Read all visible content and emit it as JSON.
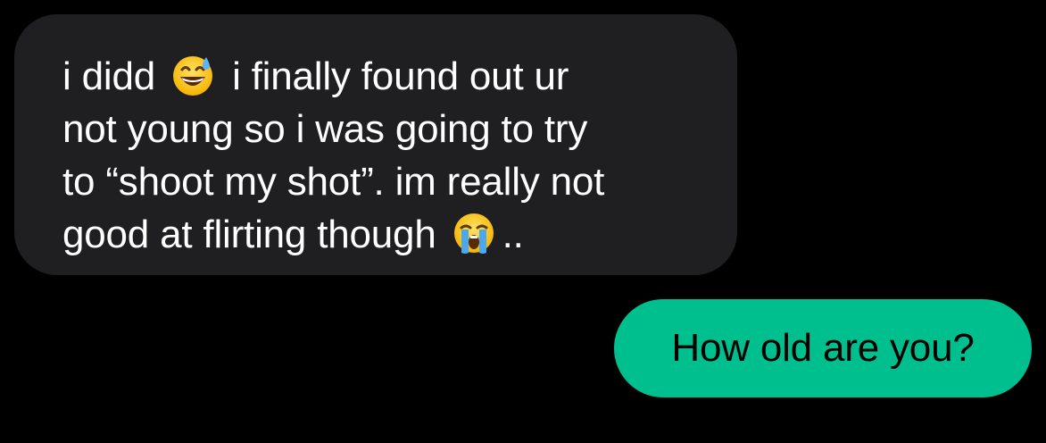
{
  "conversation": {
    "received_message": {
      "line1_before_emoji": "i didd",
      "line1_emoji": "grinning-face-with-sweat-icon",
      "line1_after_emoji": "i finally found out ur",
      "line2": "not young so i was going to try",
      "line3": "to “shoot my shot”. im really not",
      "line4_before_emoji": "good at flirting though",
      "line4_emoji": "loudly-crying-face-icon",
      "line4_after_emoji": ".."
    },
    "sent_message": {
      "text": "How old are you?"
    }
  },
  "colors": {
    "background": "#000000",
    "received_bubble": "#1f1f21",
    "sent_bubble": "#00bf8f",
    "received_text": "#ffffff",
    "sent_text": "#000000"
  }
}
